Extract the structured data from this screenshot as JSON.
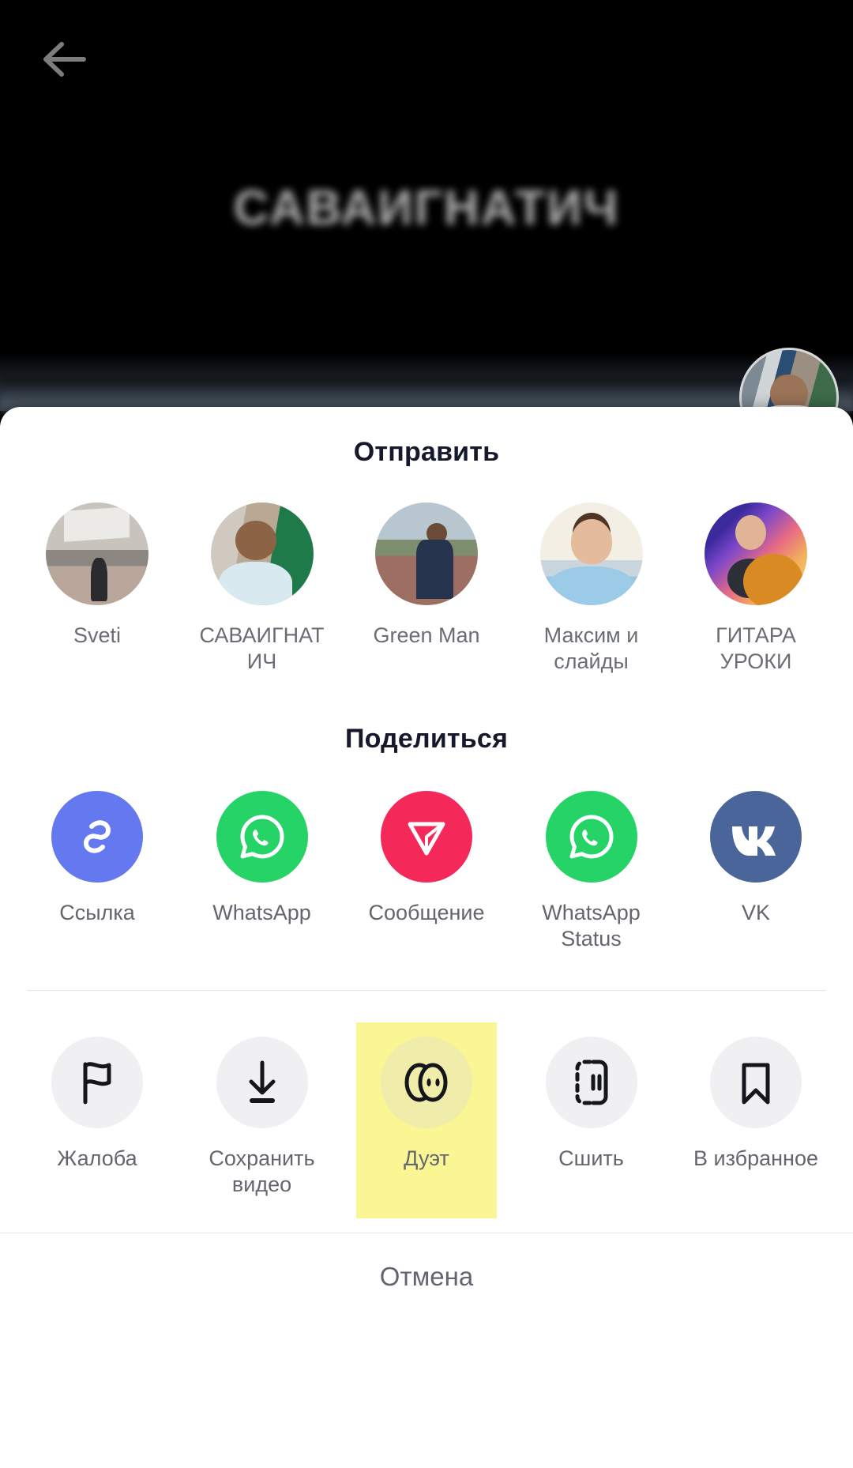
{
  "video": {
    "back_icon": "back-arrow-icon",
    "overlay_title": "САВАИГНАТИЧ",
    "author_avatar_icon": "author-avatar"
  },
  "sheet": {
    "send_title": "Отправить",
    "share_title": "Поделиться",
    "cancel_label": "Отмена"
  },
  "contacts": [
    {
      "name": "Sveti",
      "avatar_icon": "contact-avatar-sveti"
    },
    {
      "name": "САВАИГНАТИЧ",
      "avatar_icon": "contact-avatar-savaignatich"
    },
    {
      "name": "Green Man",
      "avatar_icon": "contact-avatar-green-man"
    },
    {
      "name": "Максим и слайды",
      "avatar_icon": "contact-avatar-maksim"
    },
    {
      "name": "ГИТАРА УРОКИ",
      "avatar_icon": "contact-avatar-gitara-uroki"
    }
  ],
  "share_apps": [
    {
      "label": "Ссылка",
      "icon": "link-icon",
      "color": "#6478ef"
    },
    {
      "label": "WhatsApp",
      "icon": "whatsapp-icon",
      "color": "#25d366"
    },
    {
      "label": "Сообщение",
      "icon": "telegram-send-icon",
      "color": "#f4295a"
    },
    {
      "label": "WhatsApp Status",
      "icon": "whatsapp-status-icon",
      "color": "#25d366"
    },
    {
      "label": "VK",
      "icon": "vk-icon",
      "color": "#4a659a"
    }
  ],
  "actions": [
    {
      "label": "Жалоба",
      "icon": "flag-icon",
      "highlighted": false
    },
    {
      "label": "Сохранить видео",
      "icon": "download-icon",
      "highlighted": false
    },
    {
      "label": "Дуэт",
      "icon": "duet-icon",
      "highlighted": true
    },
    {
      "label": "Сшить",
      "icon": "stitch-icon",
      "highlighted": false
    },
    {
      "label": "В избранное",
      "icon": "bookmark-icon",
      "highlighted": false
    }
  ],
  "colors": {
    "highlight": "#fbf694",
    "sheet_bg": "#ffffff",
    "label_text": "#64666e",
    "title_text": "#16182c"
  }
}
